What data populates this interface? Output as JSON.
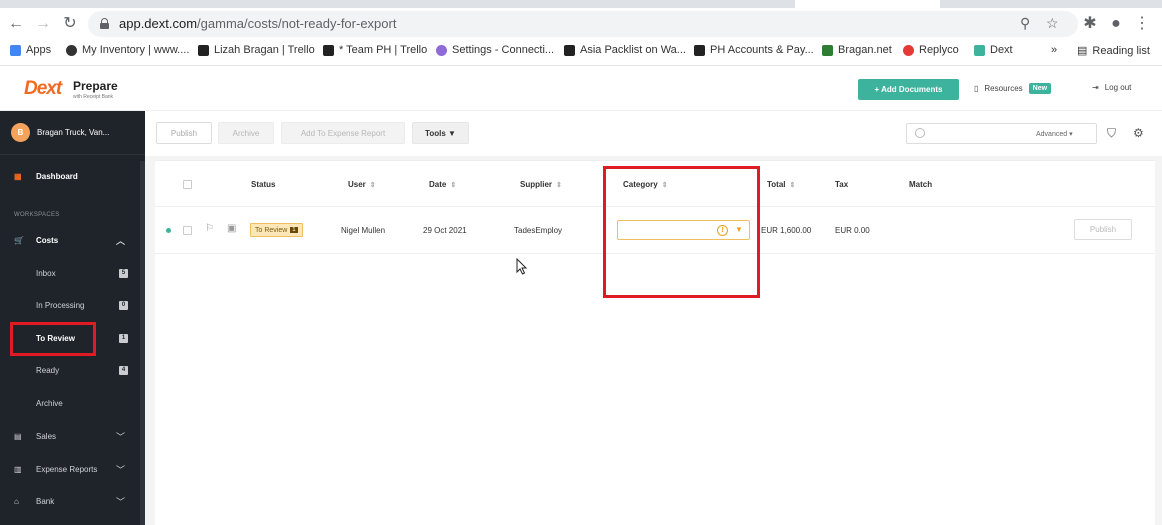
{
  "browser": {
    "url_host": "app.dext.com",
    "url_path": "/gamma/costs/not-ready-for-export",
    "bookmarks": [
      {
        "label": "Apps",
        "color": "#4285f4"
      },
      {
        "label": "My Inventory | www....",
        "color": "#333333"
      },
      {
        "label": "Lizah Bragan | Trello",
        "color": "#222222"
      },
      {
        "label": "* Team PH | Trello",
        "color": "#222222"
      },
      {
        "label": "Settings - Connecti...",
        "color": "#8e6bd8"
      },
      {
        "label": "Asia Packlist on Wa...",
        "color": "#222222"
      },
      {
        "label": "PH Accounts & Pay...",
        "color": "#222222"
      },
      {
        "label": "Bragan.net",
        "color": "#2e7d32"
      },
      {
        "label": "Replyco",
        "color": "#e53935"
      },
      {
        "label": "Dext",
        "color": "#3db39e"
      }
    ],
    "more": "»",
    "reading_list": "Reading list"
  },
  "header": {
    "logo": "Dext",
    "product": "Prepare",
    "product_sub": "with Receipt Bank",
    "add_documents": "+ Add Documents",
    "resources": "Resources",
    "new_badge": "New",
    "logout": "Log out"
  },
  "sidebar": {
    "account_initial": "B",
    "account_name": "Bragan Truck, Van...",
    "dashboard": "Dashboard",
    "workspaces": "WORKSPACES",
    "costs": "Costs",
    "items": [
      {
        "label": "Inbox",
        "count": "5"
      },
      {
        "label": "In Processing",
        "count": "0"
      },
      {
        "label": "To Review",
        "count": "1"
      },
      {
        "label": "Ready",
        "count": "4"
      },
      {
        "label": "Archive",
        "count": ""
      }
    ],
    "sales": "Sales",
    "expense_reports": "Expense Reports",
    "bank": "Bank"
  },
  "toolbar": {
    "publish": "Publish",
    "archive": "Archive",
    "add_to_expense": "Add To Expense Report",
    "tools": "Tools ▼",
    "advanced": "Advanced ▾",
    "search_placeholder": ""
  },
  "table": {
    "headers": {
      "status": "Status",
      "user": "User",
      "date": "Date",
      "supplier": "Supplier",
      "category": "Category",
      "total": "Total",
      "tax": "Tax",
      "match": "Match"
    },
    "row": {
      "status": "To Review",
      "status_count": "1",
      "user": "Nigel Mullen",
      "date": "29 Oct 2021",
      "supplier": "TadesEmploy",
      "category": "",
      "total": "EUR 1,600.00",
      "tax": "EUR 0.00",
      "publish": "Publish"
    }
  },
  "colors": {
    "brand": "#f26a21",
    "accent": "#3db39e",
    "highlight": "#e01b24"
  }
}
